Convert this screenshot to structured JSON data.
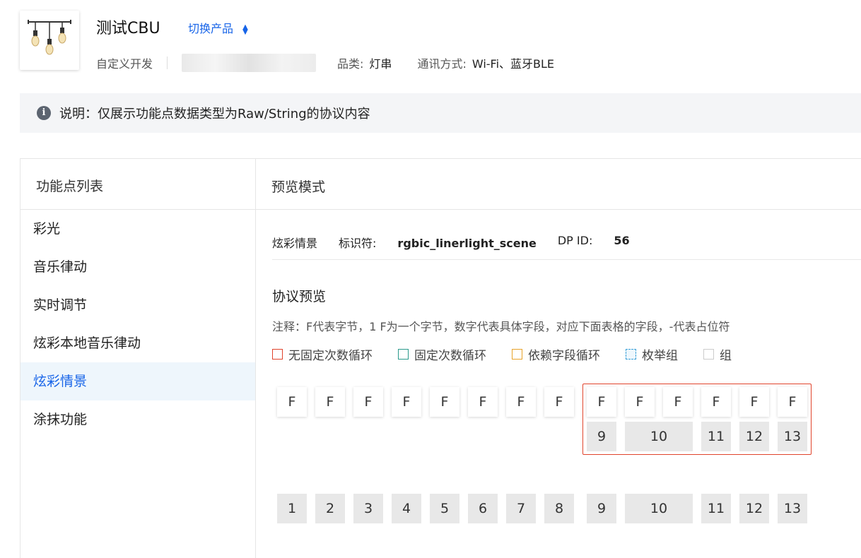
{
  "header": {
    "product_name": "测试CBU",
    "switch_label": "切换产品",
    "dev_type": "自定义开发",
    "category_label": "品类:",
    "category_value": "灯串",
    "comm_label": "通讯方式:",
    "comm_value": "Wi-Fi、蓝牙BLE"
  },
  "notice": {
    "text": "说明：仅展示功能点数据类型为Raw/String的协议内容"
  },
  "left": {
    "title": "功能点列表",
    "items": [
      {
        "label": "彩光"
      },
      {
        "label": "音乐律动"
      },
      {
        "label": "实时调节"
      },
      {
        "label": "炫彩本地音乐律动"
      },
      {
        "label": "炫彩情景"
      },
      {
        "label": "涂抹功能"
      }
    ],
    "active_index": 4
  },
  "right": {
    "title": "预览模式",
    "dp_name": "炫彩情景",
    "id_label": "标识符:",
    "id_value": "rgbic_linerlight_scene",
    "dpid_label": "DP ID:",
    "dpid_value": "56",
    "proto_title": "协议预览",
    "proto_note": "注释：F代表字节，1 F为一个字节，数字代表具体字段，对应下面表格的字段，-代表占位符",
    "legend": [
      {
        "label": "无固定次数循环",
        "color": "#e0432c",
        "style": "solid"
      },
      {
        "label": "固定次数循环",
        "color": "#2b9a8c",
        "style": "solid"
      },
      {
        "label": "依赖字段循环",
        "color": "#e8a32a",
        "style": "solid"
      },
      {
        "label": "枚举组",
        "color": "#3aa0d8",
        "style": "dashed"
      },
      {
        "label": "组",
        "color": "#cccccc",
        "style": "solid"
      }
    ]
  },
  "bytes": {
    "byte_label": "F",
    "top_row": [
      "F",
      "F",
      "F",
      "F",
      "F",
      "F",
      "F",
      "F",
      "F",
      "F",
      "F",
      "F",
      "F",
      "F"
    ],
    "loop_fields": [
      "9",
      "10",
      "11",
      "12",
      "13"
    ],
    "field_row": [
      "1",
      "2",
      "3",
      "4",
      "5",
      "6",
      "7",
      "8",
      "9",
      "10",
      "11",
      "12",
      "13"
    ]
  }
}
